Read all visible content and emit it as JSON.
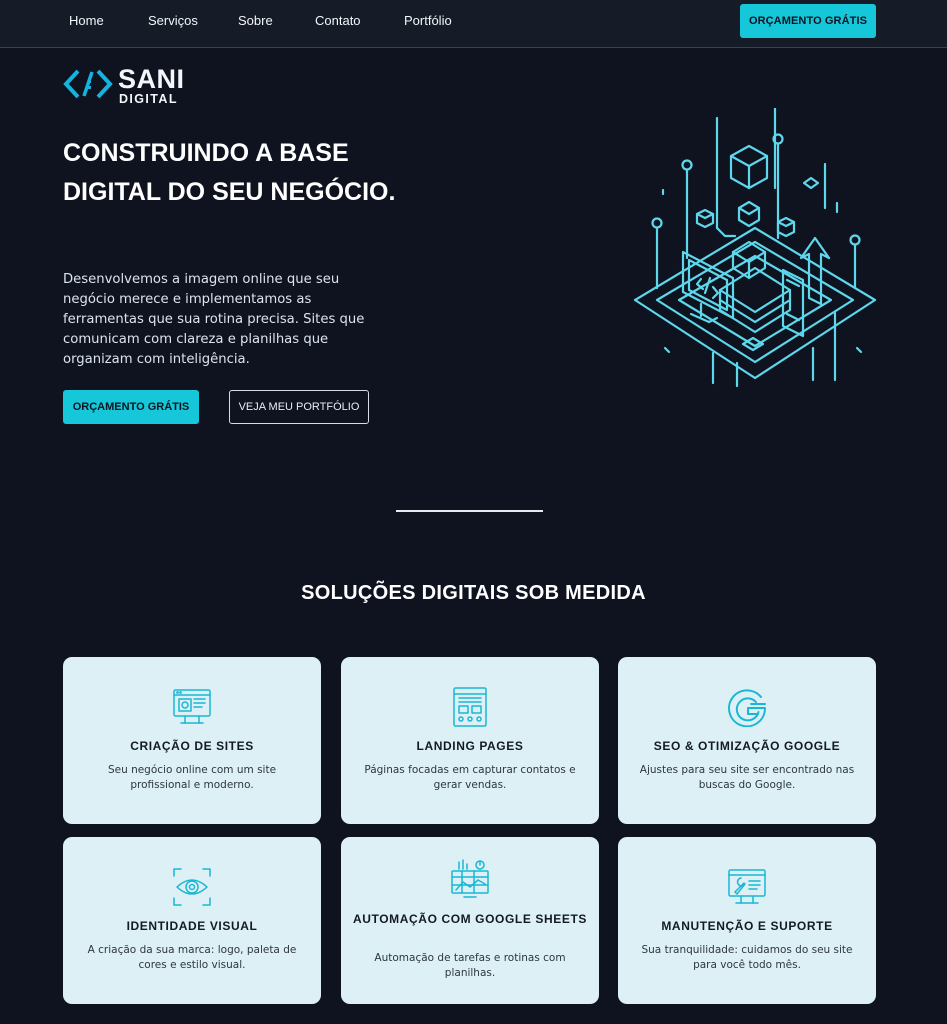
{
  "nav": {
    "links": [
      "Home",
      "Serviços",
      "Sobre",
      "Contato",
      "Portfólio"
    ],
    "cta": "ORÇAMENTO GRÁTIS"
  },
  "logo": {
    "name": "SANI",
    "sub": "DIGITAL"
  },
  "hero": {
    "title": "CONSTRUINDO A BASE DIGITAL DO SEU NEGÓCIO.",
    "text": "Desenvolvemos a imagem online que seu negócio merece e implementamos as ferramentas que sua rotina precisa. Sites que comunicam com clareza e planilhas que organizam com inteligência.",
    "primary_button": "ORÇAMENTO GRÁTIS",
    "secondary_button": "VEJA MEU PORTFÓLIO"
  },
  "services": {
    "title": "SOLUÇÕES DIGITAIS SOB MEDIDA",
    "cards": [
      {
        "icon": "website-icon",
        "title": "CRIAÇÃO DE SITES",
        "desc": "Seu negócio online com um site profissional e moderno."
      },
      {
        "icon": "landing-page-icon",
        "title": "LANDING PAGES",
        "desc": "Páginas focadas em capturar contatos e gerar vendas."
      },
      {
        "icon": "google-icon",
        "title": "SEO & OTIMIZAÇÃO GOOGLE",
        "desc": "Ajustes para seu site ser encontrado nas buscas do Google."
      },
      {
        "icon": "eye-icon",
        "title": "IDENTIDADE VISUAL",
        "desc": "A criação da sua marca: logo, paleta de cores e estilo visual."
      },
      {
        "icon": "spreadsheet-chart-icon",
        "title": "AUTOMAÇÃO COM GOOGLE SHEETS",
        "desc": "Automação de tarefas e rotinas com planilhas."
      },
      {
        "icon": "wrench-monitor-icon",
        "title": "MANUTENÇÃO E SUPORTE",
        "desc": "Sua tranquilidade: cuidamos do seu site para você todo mês."
      }
    ]
  },
  "colors": {
    "accent": "#16c6d9",
    "background": "#0e131f",
    "card": "#ddf0f6"
  }
}
